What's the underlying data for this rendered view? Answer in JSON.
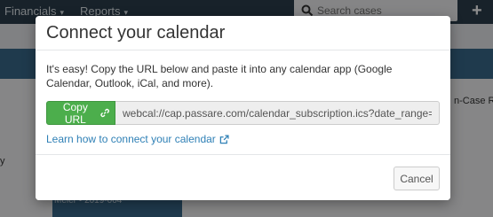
{
  "topnav": {
    "items": [
      {
        "label": "Financials"
      },
      {
        "label": "Reports"
      }
    ],
    "search_placeholder": "Search cases",
    "add_label": "+"
  },
  "background": {
    "right_label": "n-Case Re",
    "left_char": "y",
    "block_text": "Meler • 2019-004"
  },
  "modal": {
    "title": "Connect your calendar",
    "description": "It's easy! Copy the URL below and paste it into any calendar app (Google Calendar, Outlook, iCal, and more).",
    "copy_button_label": "Copy URL",
    "url_value": "webcal://cap.passare.com/calendar_subscription.ics?date_range=tru",
    "learn_link": "Learn how to connect your calendar",
    "cancel_label": "Cancel"
  },
  "colors": {
    "copy_button": "#4cae4c",
    "link": "#2f80b6",
    "nav": "#2d3f4d",
    "subbar": "#3a6a8c"
  }
}
